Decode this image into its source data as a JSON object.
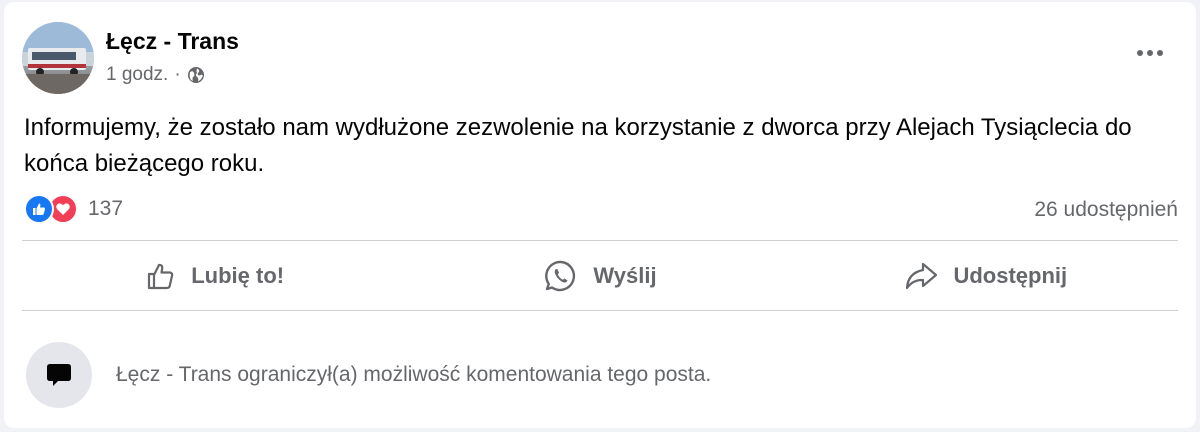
{
  "post": {
    "author": "Łęcz - Trans",
    "time": "1 godz.",
    "separator": "·",
    "audience_icon": "globe-icon",
    "more_icon": "more-options-icon",
    "text": "Informujemy, że zostało nam wydłużone zezwolenie na korzystanie z dworca przy Alejach Tysiąclecia do końca bieżącego roku."
  },
  "reactions": {
    "types": [
      "like",
      "love"
    ],
    "count": "137",
    "shares": "26 udostępnień"
  },
  "actions": {
    "like_label": "Lubię to!",
    "send_label": "Wyślij",
    "share_label": "Udostępnij"
  },
  "comments": {
    "notice": "Łęcz - Trans ograniczył(a) możliwość komentowania tego posta."
  },
  "colors": {
    "like_blue": "#1877f2",
    "love_red": "#f33e58",
    "secondary_text": "#65676b",
    "primary_text": "#050505"
  }
}
